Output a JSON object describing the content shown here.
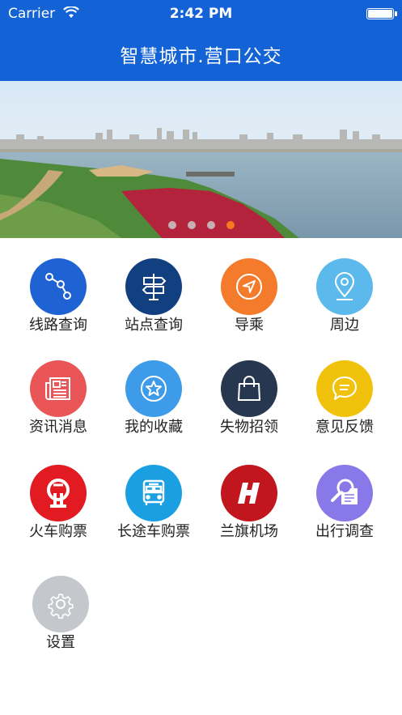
{
  "status_bar": {
    "carrier": "Carrier",
    "time": "2:42 PM"
  },
  "header": {
    "title": "智慧城市.营口公交"
  },
  "banner": {
    "slide_count": 4,
    "active_index": 3
  },
  "menu": [
    {
      "label": "线路查询",
      "icon": "route-icon",
      "color": "#1f62d4"
    },
    {
      "label": "站点查询",
      "icon": "signpost-icon",
      "color": "#123f80"
    },
    {
      "label": "导乘",
      "icon": "compass-icon",
      "color": "#f37b2b"
    },
    {
      "label": "周边",
      "icon": "location-pin-icon",
      "color": "#5bb9ec"
    },
    {
      "label": "资讯消息",
      "icon": "newspaper-icon",
      "color": "#ea5657"
    },
    {
      "label": "我的收藏",
      "icon": "star-icon",
      "color": "#3d9bea"
    },
    {
      "label": "失物招领",
      "icon": "bag-icon",
      "color": "#27374f"
    },
    {
      "label": "意见反馈",
      "icon": "feedback-bubble-icon",
      "color": "#f1c20b"
    },
    {
      "label": "火车购票",
      "icon": "railway-logo-icon",
      "color": "#e21a22"
    },
    {
      "label": "长途车购票",
      "icon": "bus-icon",
      "color": "#1aa0e2"
    },
    {
      "label": "兰旗机场",
      "icon": "airport-logo-icon",
      "color": "#c1161d"
    },
    {
      "label": "出行调查",
      "icon": "survey-magnifier-icon",
      "color": "#8979e8"
    },
    {
      "label": "设置",
      "icon": "gear-icon",
      "color": "#c4c7cb"
    }
  ]
}
